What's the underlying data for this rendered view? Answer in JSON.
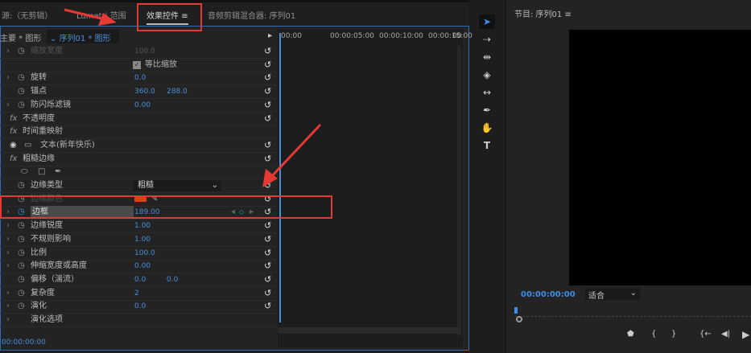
{
  "tabs": {
    "source": "源:（无剪辑）",
    "lumetri": "Lumetri 范围",
    "effect_controls": "效果控件",
    "menu": "≡",
    "audio_mixer": "音频剪辑混合器: 序列01"
  },
  "subheader": {
    "master": "主要 * 图形",
    "sequence": "序列01 * 图形"
  },
  "timeline_ruler": [
    "00:00",
    "00:00:05:00",
    "00:00:10:00",
    "00:00:15:00",
    "00"
  ],
  "rows": [
    {
      "label": "缩放宽度",
      "value": "100.0",
      "dim": true,
      "chevron": true,
      "stopwatch": true
    },
    {
      "label": "等比缩放",
      "checkbox": true
    },
    {
      "label": "旋转",
      "value": "0.0",
      "chevron": true,
      "stopwatch": true
    },
    {
      "label": "锚点",
      "value": "360.0",
      "value2": "288.0",
      "stopwatch": true
    },
    {
      "label": "防闪烁滤镜",
      "value": "0.00",
      "chevron": true,
      "stopwatch": true
    },
    {
      "label": "不透明度",
      "fx": true
    },
    {
      "label": "时间重映射",
      "fx": true,
      "norst": true
    },
    {
      "label": "文本(新年快乐)",
      "eye": true
    },
    {
      "label": "粗糙边缘",
      "fx": true
    },
    {
      "shapes": true
    },
    {
      "label": "边缘类型",
      "dropdown": "粗糙",
      "stopwatch": true
    },
    {
      "label": "边缘颜色",
      "color": "#d84315",
      "dim": true,
      "stopwatch": true
    },
    {
      "label": "边框",
      "value": "189.00",
      "chevron": true,
      "stopwatch": true,
      "selected": true
    },
    {
      "label": "边缘锐度",
      "value": "1.00",
      "chevron": true,
      "stopwatch": true
    },
    {
      "label": "不规则影响",
      "value": "1.00",
      "chevron": true,
      "stopwatch": true
    },
    {
      "label": "比例",
      "value": "100.0",
      "chevron": true,
      "stopwatch": true
    },
    {
      "label": "伸缩宽度或高度",
      "value": "0.00",
      "chevron": true,
      "stopwatch": true
    },
    {
      "label": "偏移（湍流）",
      "value": "0.0",
      "value2": "0.0",
      "stopwatch": true
    },
    {
      "label": "复杂度",
      "value": "2",
      "chevron": true,
      "stopwatch": true
    },
    {
      "label": "演化",
      "value": "0.0",
      "chevron": true,
      "stopwatch": true
    },
    {
      "label": "演化选项",
      "chevron": true,
      "norst": true
    }
  ],
  "bottom_timecode": "00:00:00:00",
  "program": {
    "title": "节目: 序列01",
    "menu": "≡",
    "timecode": "00:00:00:00",
    "fit": "适合"
  },
  "colors": {
    "accent": "#2d6fb5",
    "annotation": "#e53935"
  }
}
